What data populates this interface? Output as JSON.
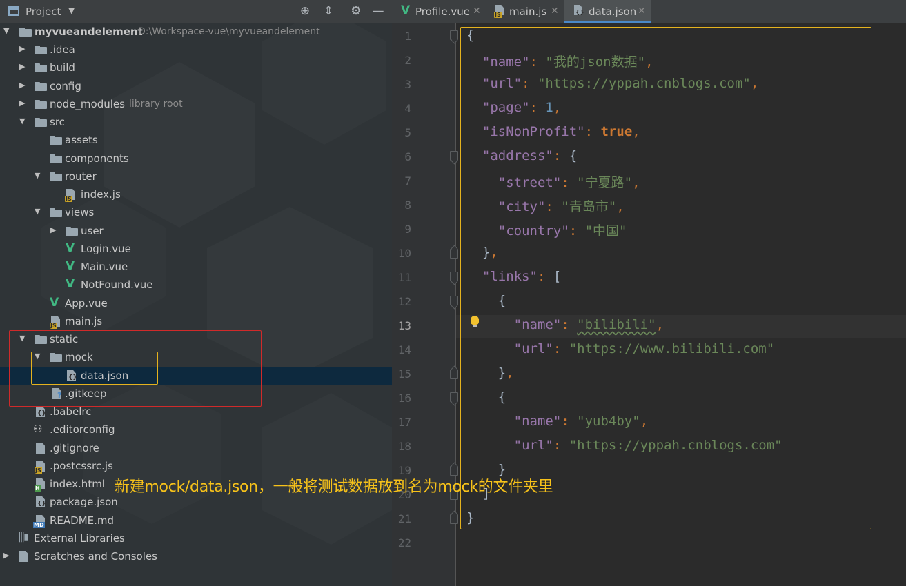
{
  "project_panel": {
    "title": "Project",
    "header_icons": [
      "target-icon",
      "collapse-icon",
      "gear-icon",
      "minimize-icon"
    ],
    "tree": [
      {
        "label": "myvueandelement",
        "sub": "D:\\Workspace-vue\\myvueandelement",
        "icon": "module-folder-icon",
        "state": "expanded"
      },
      {
        "label": ".idea",
        "icon": "folder-icon",
        "state": "collapsed"
      },
      {
        "label": "build",
        "icon": "folder-icon",
        "state": "collapsed"
      },
      {
        "label": "config",
        "icon": "folder-icon",
        "state": "collapsed"
      },
      {
        "label": "node_modules",
        "sub": "library root",
        "icon": "folder-icon",
        "state": "collapsed"
      },
      {
        "label": "src",
        "icon": "folder-icon",
        "state": "expanded"
      },
      {
        "label": "assets",
        "icon": "folder-icon"
      },
      {
        "label": "components",
        "icon": "folder-icon"
      },
      {
        "label": "router",
        "icon": "folder-icon",
        "state": "expanded"
      },
      {
        "label": "index.js",
        "icon": "js-file-icon"
      },
      {
        "label": "views",
        "icon": "folder-icon",
        "state": "expanded"
      },
      {
        "label": "user",
        "icon": "folder-icon",
        "state": "collapsed"
      },
      {
        "label": "Login.vue",
        "icon": "vue-file-icon"
      },
      {
        "label": "Main.vue",
        "icon": "vue-file-icon"
      },
      {
        "label": "NotFound.vue",
        "icon": "vue-file-icon"
      },
      {
        "label": "App.vue",
        "icon": "vue-file-icon"
      },
      {
        "label": "main.js",
        "icon": "js-file-icon"
      },
      {
        "label": "static",
        "icon": "folder-icon",
        "state": "expanded"
      },
      {
        "label": "mock",
        "icon": "folder-icon",
        "state": "expanded"
      },
      {
        "label": "data.json",
        "icon": "json-file-icon",
        "selected": true
      },
      {
        "label": ".gitkeep",
        "icon": "unknown-file-icon"
      },
      {
        "label": ".babelrc",
        "icon": "json-file-icon"
      },
      {
        "label": ".editorconfig",
        "icon": "editorconfig-icon"
      },
      {
        "label": ".gitignore",
        "icon": "text-file-icon"
      },
      {
        "label": ".postcssrc.js",
        "icon": "js-file-icon"
      },
      {
        "label": "index.html",
        "icon": "html-file-icon"
      },
      {
        "label": "package.json",
        "icon": "json-file-icon"
      },
      {
        "label": "README.md",
        "icon": "md-file-icon"
      },
      {
        "label": "External Libraries",
        "icon": "libraries-icon"
      },
      {
        "label": "Scratches and Consoles",
        "icon": "scratches-icon",
        "state": "collapsed"
      }
    ]
  },
  "tabs": [
    {
      "label": "Profile.vue",
      "icon": "vue-file-icon",
      "active": false
    },
    {
      "label": "main.js",
      "icon": "js-file-icon",
      "active": false
    },
    {
      "label": "data.json",
      "icon": "json-file-icon",
      "active": true
    }
  ],
  "editor": {
    "current_line": 13,
    "line_numbers": [
      "1",
      "2",
      "3",
      "4",
      "5",
      "6",
      "7",
      "8",
      "9",
      "10",
      "11",
      "12",
      "13",
      "14",
      "15",
      "16",
      "17",
      "18",
      "19",
      "20",
      "21",
      "22"
    ],
    "code": {
      "l2_key": "\"name\"",
      "l2_val": "\"我的json数据\"",
      "l3_key": "\"url\"",
      "l3_val": "\"https://yppah.cnblogs.com\"",
      "l4_key": "\"page\"",
      "l4_val": "1",
      "l5_key": "\"isNonProfit\"",
      "l5_val": "true",
      "l6_key": "\"address\"",
      "l7_key": "\"street\"",
      "l7_val": "\"宁夏路\"",
      "l8_key": "\"city\"",
      "l8_val": "\"青岛市\"",
      "l9_key": "\"country\"",
      "l9_val": "\"中国\"",
      "l11_key": "\"links\"",
      "l13_key": "\"name\"",
      "l13_val": "\"bilibili\"",
      "l14_key": "\"url\"",
      "l14_val": "\"https://www.bilibili.com\"",
      "l17_key": "\"name\"",
      "l17_val": "\"yub4by\"",
      "l18_key": "\"url\"",
      "l18_val": "\"https://yppah.cnblogs.com\""
    }
  },
  "annotation": "新建mock/data.json，一般将测试数据放到名为mock的文件夹里",
  "colors": {
    "annotation": "#f7c21a",
    "highlight_red": "#d02a2a",
    "highlight_yellow": "#e4b21e",
    "selection": "#0d293e"
  }
}
